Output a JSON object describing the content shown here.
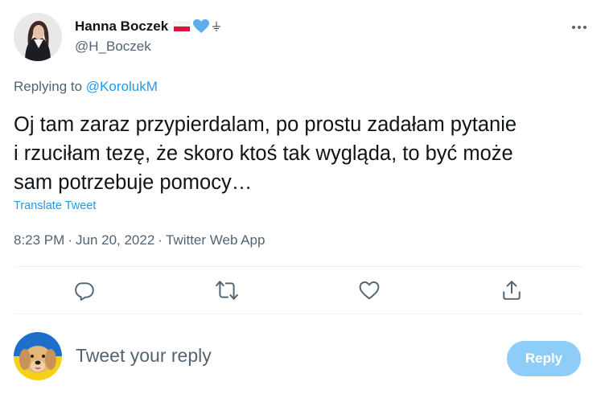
{
  "author": {
    "display_name": "Hanna Boczek",
    "handle": "@H_Boczek",
    "badges": [
      "poland-flag-icon",
      "blue-heart-icon",
      "earth-ground-symbol-icon"
    ]
  },
  "replying_to": {
    "prefix": "Replying to",
    "handle": "@KorolukM"
  },
  "tweet": {
    "text": "Oj tam zaraz przypierdalam, po prostu zadałam pytanie\ni rzuciłam tezę, że skoro ktoś tak wygląda, to być może\nsam potrzebuje pomocy…",
    "translate_label": "Translate Tweet",
    "time": "8:23 PM",
    "separator": "·",
    "date": "Jun 20, 2022",
    "source": "Twitter Web App"
  },
  "actions": {
    "icons": [
      "reply-icon",
      "retweet-icon",
      "like-icon",
      "share-icon"
    ]
  },
  "compose": {
    "placeholder": "Tweet your reply",
    "button_label": "Reply"
  },
  "colors": {
    "accent": "#1d9bf0",
    "reply_button_disabled": "#8ecdf8",
    "secondary_text": "#536471",
    "primary_text": "#0f1419"
  }
}
